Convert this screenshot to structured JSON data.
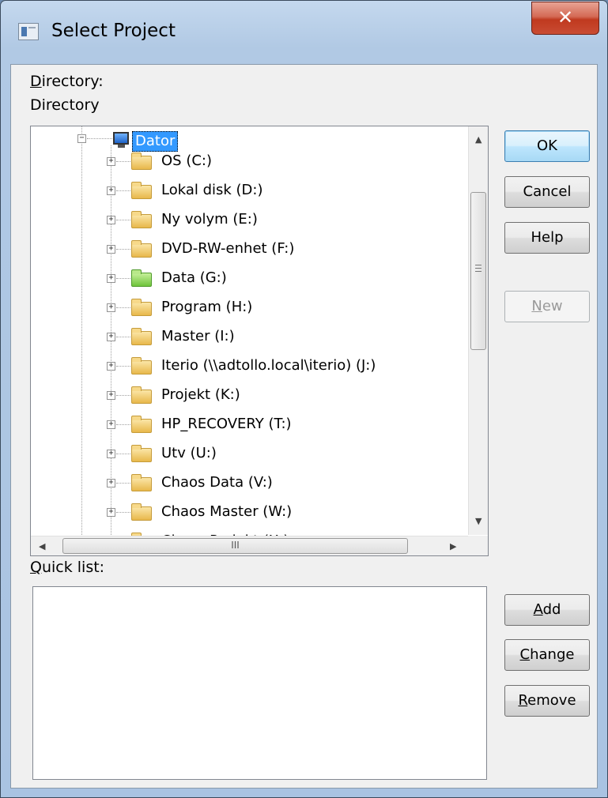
{
  "window": {
    "title": "Select Project",
    "close_glyph": "✕"
  },
  "directory": {
    "label": "Directory:",
    "label_accel": "D",
    "label_rest": "irectory:",
    "value": "Directory"
  },
  "tree": {
    "root": {
      "label": "Dator",
      "icon": "computer-icon",
      "expander": "−"
    },
    "items": [
      {
        "label": "OS (C:)",
        "icon": "folder-icon"
      },
      {
        "label": "Lokal disk (D:)",
        "icon": "folder-icon"
      },
      {
        "label": "Ny volym (E:)",
        "icon": "folder-icon"
      },
      {
        "label": "DVD-RW-enhet (F:)",
        "icon": "folder-icon"
      },
      {
        "label": "Data (G:)",
        "icon": "green-folder-icon",
        "color": "#6fc43b"
      },
      {
        "label": "Program (H:)",
        "icon": "folder-icon"
      },
      {
        "label": "Master (I:)",
        "icon": "folder-icon"
      },
      {
        "label": "Iterio (\\\\adtollo.local\\iterio) (J:)",
        "icon": "folder-icon"
      },
      {
        "label": "Projekt (K:)",
        "icon": "folder-icon"
      },
      {
        "label": "HP_RECOVERY (T:)",
        "icon": "folder-icon"
      },
      {
        "label": "Utv (U:)",
        "icon": "folder-icon"
      },
      {
        "label": "Chaos Data (V:)",
        "icon": "folder-icon"
      },
      {
        "label": "Chaos Master (W:)",
        "icon": "folder-icon"
      },
      {
        "label": "Chaos Projekt (X:)",
        "icon": "folder-icon"
      }
    ],
    "hscroll_grip": "III"
  },
  "buttons": {
    "ok": "OK",
    "cancel": "Cancel",
    "help": "Help",
    "new_accel": "N",
    "new_rest": "ew",
    "add_accel": "A",
    "add_rest": "dd",
    "change_accel": "C",
    "change_rest": "hange",
    "remove_accel": "R",
    "remove_rest": "emove"
  },
  "quicklist": {
    "label_accel": "Q",
    "label_rest": "uick list:"
  },
  "colors": {
    "selection": "#3399ff",
    "close": "#c94c33"
  }
}
